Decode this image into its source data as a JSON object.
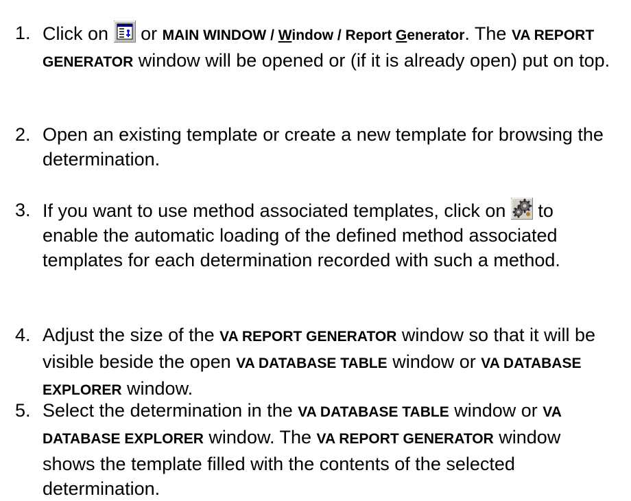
{
  "steps": [
    {
      "number": "1.",
      "click_on": "Click on",
      "or": "or",
      "menu_a": "MAIN WINDOW / ",
      "menu_w": "W",
      "menu_b": "indow / Report ",
      "menu_g": "G",
      "menu_c": "enerator",
      "after_menu": ". The",
      "window_name": "VA REPORT GENERATOR",
      "rest": " window will be opened or (if it is already open) put on top.",
      "icon": "report-generator-icon"
    },
    {
      "number": "2.",
      "text": "Open an existing template or create a new template for browsing the determination."
    },
    {
      "number": "3.",
      "text_a": "If you want to use method associated templates, click on",
      "text_b": "to enable the automatic loading of the defined method associated templates for each determination recorded with such a method.",
      "icon": "method-templates-icon"
    },
    {
      "number": "4.",
      "text_a": "Adjust the size of the ",
      "window_a": "VA REPORT GENERATOR",
      "text_b": " window so that it will be visible beside the open ",
      "window_b": "VA DATABASE TABLE",
      "text_c": " window or ",
      "window_c": "VA DATABASE EXPLORER",
      "text_d": " window."
    },
    {
      "number": "5.",
      "text_a": "Select the determination in the ",
      "window_a": "VA DATABASE TABLE",
      "text_b": " window or ",
      "window_b": "VA DATABASE EXPLORER",
      "text_c": " window. The ",
      "window_c": "VA REPORT GENERATOR",
      "text_d": " window shows the template filled with the contents of the selected determination."
    }
  ]
}
